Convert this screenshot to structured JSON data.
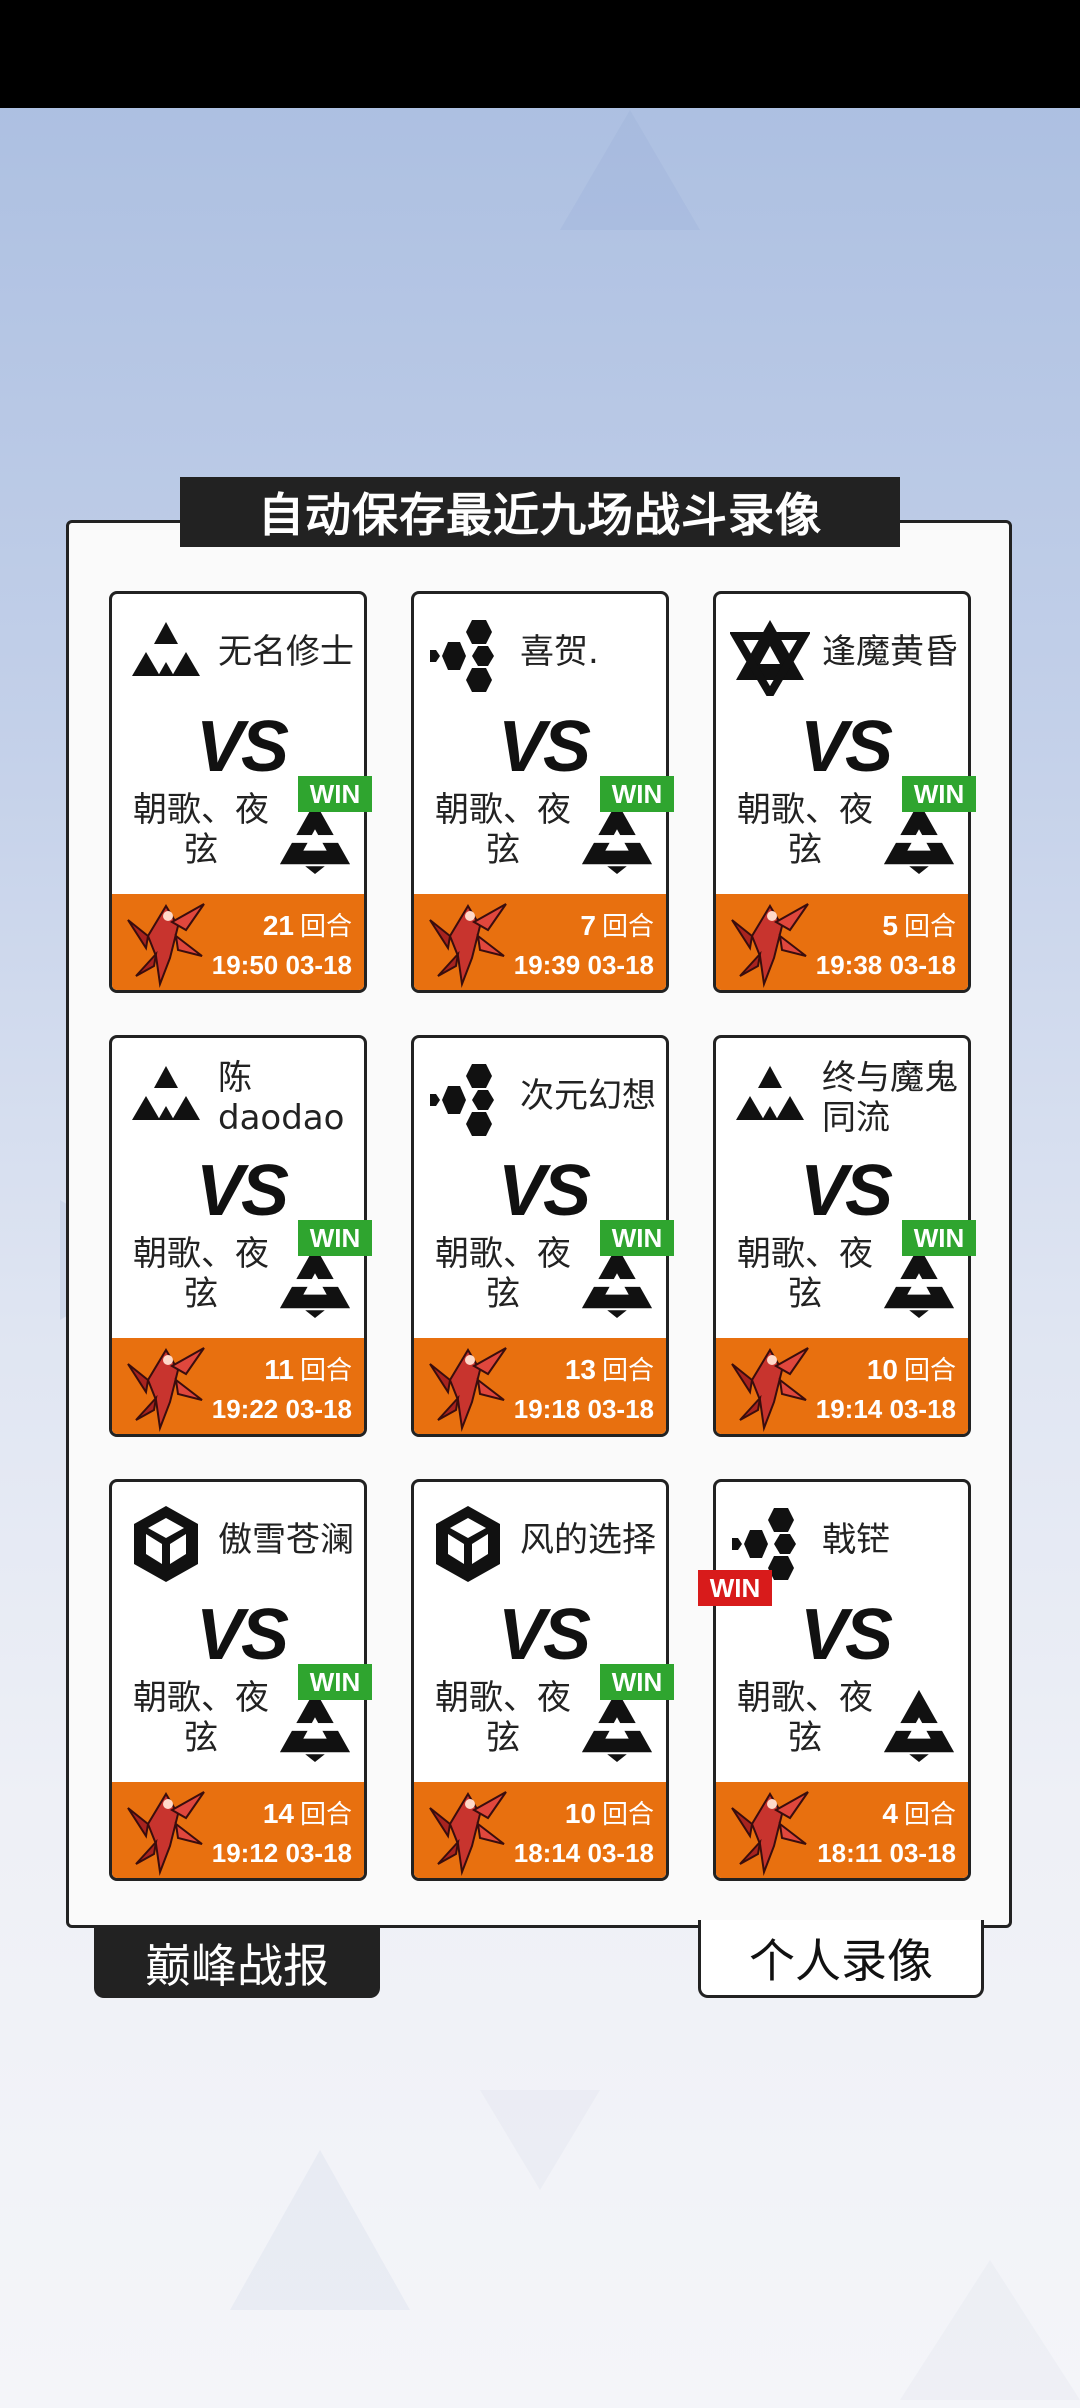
{
  "title": "自动保存最近九场战斗录像",
  "tabs": [
    {
      "label": "巅峰战报",
      "selected": true
    },
    {
      "label": "个人录像",
      "selected": false
    }
  ],
  "vs_label": "VS",
  "rounds_unit": "回合",
  "records": [
    {
      "opponent": "无名修士",
      "opponent_icon": "triangle-cluster-icon",
      "team": "朝歌、夜弦",
      "my_icon": "a-triangle-icon",
      "win_side": "mine",
      "win_label": "WIN",
      "rounds": "21",
      "time": "19:50 03-18"
    },
    {
      "opponent": "喜贺.",
      "opponent_icon": "hexagon-cluster-icon",
      "team": "朝歌、夜弦",
      "my_icon": "a-triangle-icon",
      "win_side": "mine",
      "win_label": "WIN",
      "rounds": "7",
      "time": "19:39 03-18"
    },
    {
      "opponent": "逢魔黄昏",
      "opponent_icon": "star-triangle-icon",
      "team": "朝歌、夜弦",
      "my_icon": "a-triangle-icon",
      "win_side": "mine",
      "win_label": "WIN",
      "rounds": "5",
      "time": "19:38 03-18"
    },
    {
      "opponent": "陈daodao",
      "opponent_icon": "triangle-cluster-icon",
      "team": "朝歌、夜弦",
      "my_icon": "a-triangle-icon",
      "win_side": "mine",
      "win_label": "WIN",
      "rounds": "11",
      "time": "19:22 03-18"
    },
    {
      "opponent": "次元幻想",
      "opponent_icon": "hexagon-cluster-icon",
      "team": "朝歌、夜弦",
      "my_icon": "a-triangle-icon",
      "win_side": "mine",
      "win_label": "WIN",
      "rounds": "13",
      "time": "19:18 03-18"
    },
    {
      "opponent": "终与魔鬼同流",
      "opponent_icon": "triangle-cluster-icon",
      "team": "朝歌、夜弦",
      "my_icon": "a-triangle-icon",
      "win_side": "mine",
      "win_label": "WIN",
      "rounds": "10",
      "time": "19:14 03-18"
    },
    {
      "opponent": "傲雪苍澜",
      "opponent_icon": "cube-icon",
      "team": "朝歌、夜弦",
      "my_icon": "a-triangle-icon",
      "win_side": "mine",
      "win_label": "WIN",
      "rounds": "14",
      "time": "19:12 03-18"
    },
    {
      "opponent": "风的选择",
      "opponent_icon": "cube-icon",
      "team": "朝歌、夜弦",
      "my_icon": "a-triangle-icon",
      "win_side": "mine",
      "win_label": "WIN",
      "rounds": "10",
      "time": "18:14 03-18"
    },
    {
      "opponent": "戟铓",
      "opponent_icon": "hexagon-cluster-icon",
      "team": "朝歌、夜弦",
      "my_icon": "a-triangle-icon",
      "win_side": "opponent",
      "win_label": "WIN",
      "rounds": "4",
      "time": "18:11 03-18"
    }
  ],
  "colors": {
    "footer": "#e8700f",
    "win_green": "#2fa52f",
    "win_red": "#d81b1b",
    "dark": "#222222"
  }
}
